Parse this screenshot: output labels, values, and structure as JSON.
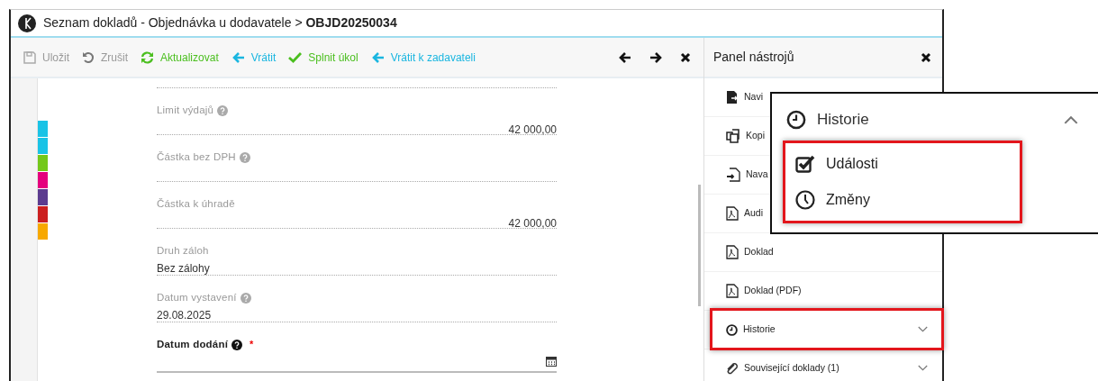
{
  "window": {
    "title": "Seznam dokladů - Objednávka u dodavatele > **OBJD20250034**"
  },
  "toolbar": [
    {
      "label": "Uložit",
      "kind": "save",
      "disabled": true
    },
    {
      "label": "Zrušit",
      "kind": "undo",
      "disabled": true
    },
    {
      "label": "Aktualizovat",
      "kind": "refresh",
      "disabled": false
    },
    {
      "label": "Vrátit",
      "kind": "back",
      "disabled": false
    },
    {
      "label": "Splnit úkol",
      "kind": "complete",
      "disabled": false
    },
    {
      "label": "Vrátit k zadavateli",
      "kind": "back",
      "disabled": false
    }
  ],
  "side_tabs": [
    {
      "color": "#19c3e6"
    },
    {
      "color": "#19c3e6"
    },
    {
      "color": "#74c81a"
    },
    {
      "color": "#e5007d"
    },
    {
      "color": "#5c3b8f"
    },
    {
      "color": "#cc1f1f"
    },
    {
      "color": "#f7a800"
    }
  ],
  "fields": [
    {
      "label": "Limit výdajů",
      "help": true,
      "value": "42 000,00",
      "kind": "amount"
    },
    {
      "label": "Částka bez DPH",
      "help": true,
      "kind": "amount"
    },
    {
      "label": "Částka k úhradě",
      "help": false,
      "value": "42 000,00",
      "kind": "amount"
    },
    {
      "label": "Druh záloh",
      "help": false,
      "value": "Bez zálohy",
      "kind": "text"
    },
    {
      "label": "Datum vystavení",
      "help": true,
      "value": "29.08.2025",
      "kind": "text"
    },
    {
      "label": "Datum dodání",
      "help": true,
      "kind": "date",
      "required_mark": "*"
    }
  ],
  "panel": {
    "title": "Panel nástrojů",
    "items": [
      {
        "label": "Navi",
        "kind": "export",
        "expandable": false,
        "highlighted": false
      },
      {
        "label": "Kopi",
        "kind": "copy",
        "expandable": false,
        "highlighted": false
      },
      {
        "label": "Nava",
        "kind": "import",
        "expandable": false,
        "highlighted": false
      },
      {
        "label": "Audi",
        "kind": "pdf",
        "expandable": false,
        "highlighted": false
      },
      {
        "label": "Doklad",
        "kind": "pdf",
        "expandable": false,
        "highlighted": false
      },
      {
        "label": "Doklad (PDF)",
        "kind": "pdf",
        "expandable": false,
        "highlighted": false
      },
      {
        "label": "Historie",
        "kind": "history",
        "expandable": true,
        "highlighted": true
      },
      {
        "label": "Související doklady (1)",
        "kind": "attachment",
        "expandable": true,
        "highlighted": false
      }
    ]
  },
  "popup": {
    "title": "Historie",
    "expanded": true,
    "highlighted": true,
    "items": [
      {
        "label": "Události",
        "kind": "events"
      },
      {
        "label": "Změny",
        "kind": "changes"
      }
    ]
  }
}
